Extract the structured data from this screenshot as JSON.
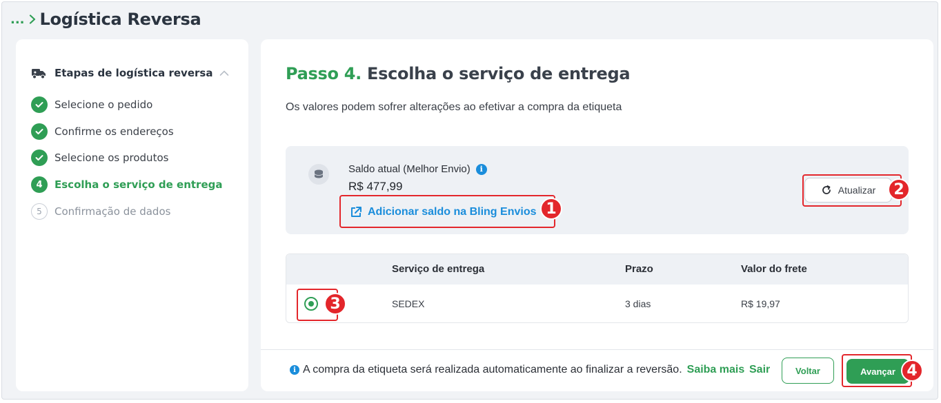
{
  "breadcrumb": {
    "ellipsis": "...",
    "title": "Logística Reversa"
  },
  "sidebar": {
    "heading": "Etapas de logística reversa",
    "steps": [
      {
        "label": "Selecione o pedido",
        "status": "done"
      },
      {
        "label": "Confirme os endereços",
        "status": "done"
      },
      {
        "label": "Selecione os produtos",
        "status": "done"
      },
      {
        "label": "Escolha o serviço de entrega",
        "status": "current",
        "number": "4"
      },
      {
        "label": "Confirmação de dados",
        "status": "pending",
        "number": "5"
      }
    ]
  },
  "main": {
    "step_label": "Passo 4.",
    "title": "Escolha o serviço de entrega",
    "subtitle": "Os valores podem sofrer alterações ao efetivar a compra da etiqueta",
    "balance": {
      "label": "Saldo atual (Melhor Envio)",
      "value": "R$ 477,99",
      "add_link": "Adicionar saldo na Bling Envios",
      "refresh_label": "Atualizar"
    },
    "table": {
      "headers": {
        "service": "Serviço de entrega",
        "prazo": "Prazo",
        "valor": "Valor do frete"
      },
      "rows": [
        {
          "service": "SEDEX",
          "prazo": "3 dias",
          "valor": "R$ 19,97",
          "selected": true
        }
      ]
    },
    "footer": {
      "notice": "A compra da etiqueta será realizada automaticamente ao finalizar a reversão.",
      "saiba_mais": "Saiba mais",
      "sair": "Sair",
      "voltar": "Voltar",
      "avancar": "Avançar"
    }
  },
  "annotations": {
    "b1": "1",
    "b2": "2",
    "b3": "3",
    "b4": "4"
  },
  "colors": {
    "accent": "#2f9e55",
    "link": "#1a8ddb",
    "highlight": "#e3262b"
  },
  "icons": [
    "chevron-right-icon",
    "truck-icon",
    "chevron-up-icon",
    "check-icon",
    "coins-icon",
    "info-icon",
    "external-link-icon",
    "refresh-icon",
    "radio-icon"
  ]
}
